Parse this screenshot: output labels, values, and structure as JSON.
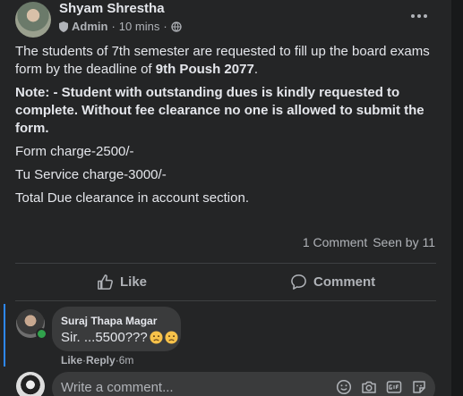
{
  "post": {
    "author": "Shyam Shrestha",
    "role": "Admin",
    "time": "10 mins",
    "separator": "·",
    "paragraph1_prefix": "The students of 7th semester are requested to fill up the board exams form by the deadline of ",
    "paragraph1_bold": "9th Poush 2077",
    "paragraph1_suffix": ".",
    "note": "Note: - Student with outstanding dues is kindly requested to complete. Without fee clearance no one is allowed to submit the form.",
    "line_form": "Form charge-2500/-",
    "line_service": "Tu Service charge-3000/-",
    "line_due": "Total Due clearance in account section."
  },
  "stats": {
    "comments": "1 Comment",
    "seen": "Seen by 11"
  },
  "actions": {
    "like": "Like",
    "comment": "Comment"
  },
  "comment": {
    "author": "Suraj Thapa Magar",
    "text": "Sir. ...5500???",
    "like": "Like",
    "dot": " · ",
    "reply": "Reply",
    "time": "6m"
  },
  "composer": {
    "placeholder": "Write a comment..."
  },
  "icons": {
    "more": "more-options-icon",
    "globe": "globe-icon",
    "admin": "admin-shield-icon",
    "like": "thumbs-up-icon",
    "comment": "comment-bubble-icon",
    "emoji": "emoji-icon",
    "camera": "camera-icon",
    "gif": "gif-icon",
    "sticker": "sticker-icon"
  },
  "colors": {
    "background": "#18191a",
    "card": "#242526",
    "bubble": "#3a3b3c",
    "accent": "#2d88ff",
    "online": "#31a24c"
  }
}
